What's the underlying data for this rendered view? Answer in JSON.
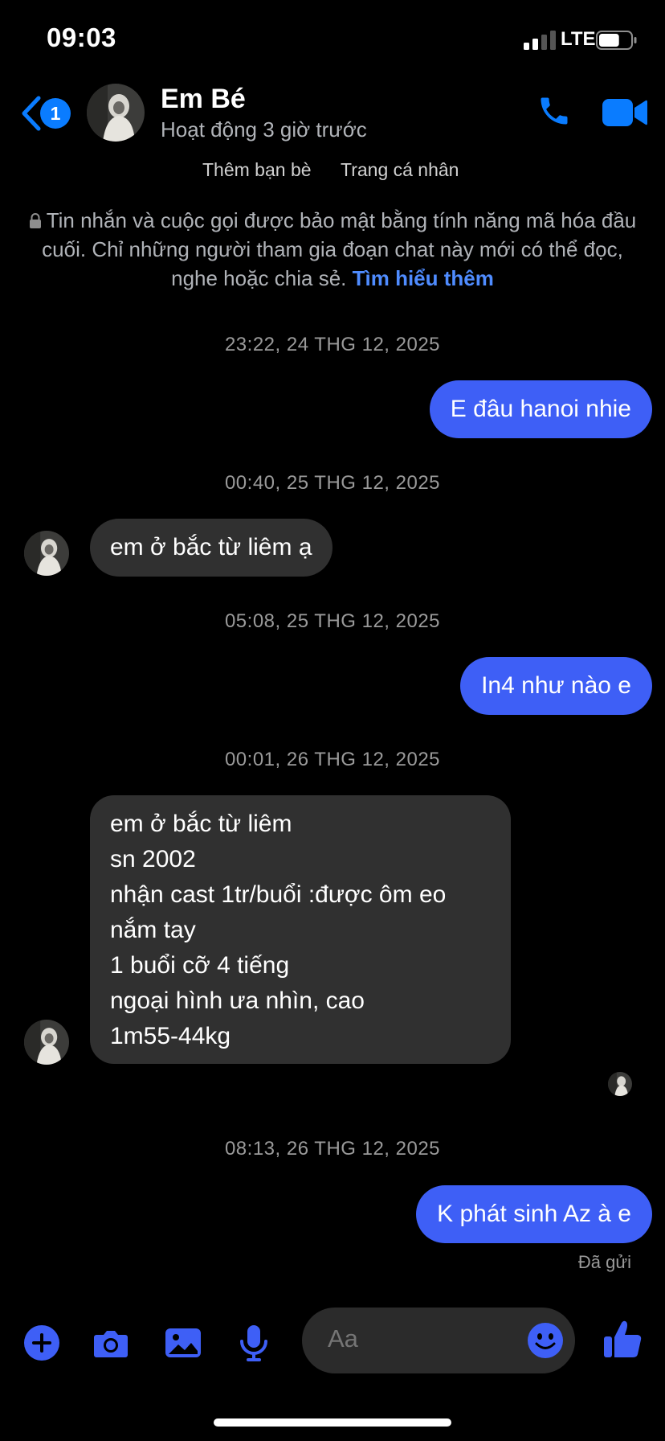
{
  "status_bar": {
    "time": "09:03",
    "network": "LTE",
    "battery_level": 0.65
  },
  "header": {
    "back_count": "1",
    "contact_name": "Em Bé",
    "contact_status": "Hoạt động 3 giờ trước",
    "actions": [
      "phone-icon",
      "video-camera-icon"
    ]
  },
  "profile_links": {
    "add_friend": "Thêm bạn bè",
    "profile": "Trang cá nhân"
  },
  "encryption_notice": {
    "text": "Tin nhắn và cuộc gọi được bảo mật bằng tính năng mã hóa đầu cuối. Chỉ những người tham gia đoạn chat này mới có thể đọc, nghe hoặc chia sẻ.",
    "link": "Tìm hiểu thêm"
  },
  "messages": [
    {
      "timestamp": "23:22, 24 THG 12, 2025"
    },
    {
      "from": "me",
      "text": "E đâu hanoi nhie"
    },
    {
      "timestamp": "00:40, 25 THG 12, 2025"
    },
    {
      "from": "them",
      "text": "em ở bắc từ liêm ạ"
    },
    {
      "timestamp": "05:08, 25 THG 12, 2025"
    },
    {
      "from": "me",
      "text": "In4 như nào e"
    },
    {
      "timestamp": "00:01, 26 THG 12, 2025"
    },
    {
      "from": "them",
      "lines": [
        "em ở bắc từ liêm",
        "sn 2002",
        "nhận cast 1tr/buổi :được ôm eo",
        "nắm tay",
        "1 buổi cỡ 4 tiếng",
        "ngoại hình ưa nhìn, cao",
        "1m55-44kg"
      ]
    },
    {
      "timestamp": "08:13, 26 THG 12, 2025"
    },
    {
      "from": "me",
      "text": "K phát sinh Az à e",
      "status": "Đã gửi"
    }
  ],
  "composer": {
    "placeholder": "Aa",
    "tools": [
      "plus-icon",
      "camera-icon",
      "image-icon",
      "microphone-icon",
      "emoji-icon",
      "thumbs-up-icon"
    ]
  },
  "colors": {
    "accent": "#0a7cff",
    "outgoing_bubble": "#3e5ff6",
    "incoming_bubble": "#303030",
    "link": "#4f8cff",
    "background": "#000000"
  }
}
